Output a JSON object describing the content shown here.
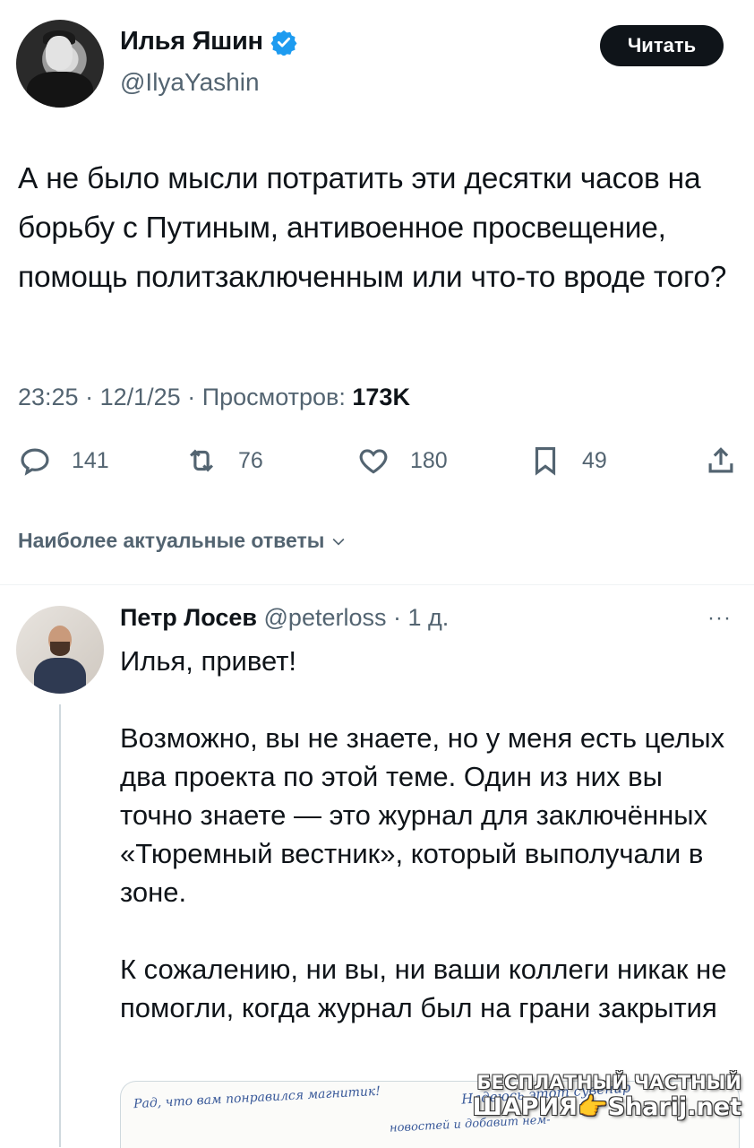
{
  "tweet": {
    "author": "Илья Яшин",
    "handle": "@IlyaYashin",
    "follow_label": "Читать",
    "text": "А не было мысли потратить эти десятки часов на борьбу с Путиным, антивоенное просвещение, помощь политзаключенным или что-то вроде того?",
    "time": "23:25",
    "date": "12/1/25",
    "views_label": "Просмотров:",
    "views": "173K",
    "stats": {
      "replies": "141",
      "reposts": "76",
      "likes": "180",
      "bookmarks": "49"
    }
  },
  "replies_sort": "Наиболее актуальные ответы",
  "reply": {
    "author": "Петр Лосев",
    "handle": "@peterloss",
    "age": "1 д.",
    "more": "···",
    "text": "Илья, привет!\n\nВозможно, вы не знаете, но у меня есть целых два проекта по этой теме. Один из них вы точно знаете — это журнал для заключённых «Тюремный вестник», который выполучали в зоне.\n\nК сожалению, ни вы, ни ваши коллеги никак не помогли, когда журнал был на грани закрытия",
    "attachment_handwriting": [
      "Рад, что вам понравился магнитик!",
      "Надеюсь этот сувенир",
      "новостей и добавит нем-"
    ]
  },
  "watermark": {
    "line1": "БЕСПЛАТНЫЙ ЧАСТНЫЙ",
    "line2": "ШАРИЯ👉Sharij.net"
  },
  "colors": {
    "text": "#0f1419",
    "secondary": "#536471",
    "verified": "#1d9bf0",
    "divider": "#eff3f4"
  }
}
